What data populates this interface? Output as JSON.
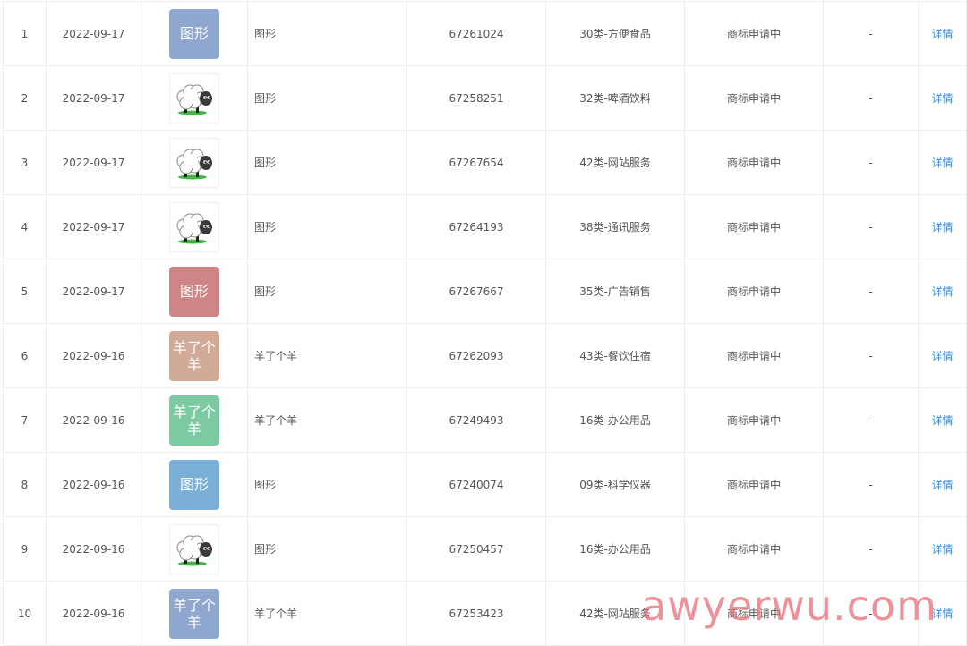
{
  "columns": {
    "detail_label": "详情"
  },
  "colors": {
    "thumb_blue_gray": "#8fa7cf",
    "thumb_red": "#cf8585",
    "thumb_tan": "#d2aa98",
    "thumb_green": "#7dc9a2",
    "thumb_blue": "#7ab0d8",
    "link": "#3b8fe0"
  },
  "rows": [
    {
      "index": "1",
      "date": "2022-09-17",
      "thumb": {
        "type": "text",
        "text": "图形",
        "color": "#8fa7cf"
      },
      "name": "图形",
      "reg_no": "67261024",
      "class": "30类-方便食品",
      "status": "商标申请中",
      "extra": "-",
      "action": "详情"
    },
    {
      "index": "2",
      "date": "2022-09-17",
      "thumb": {
        "type": "sheep-icon",
        "text": "",
        "color": "#ffffff"
      },
      "name": "图形",
      "reg_no": "67258251",
      "class": "32类-啤酒饮料",
      "status": "商标申请中",
      "extra": "-",
      "action": "详情"
    },
    {
      "index": "3",
      "date": "2022-09-17",
      "thumb": {
        "type": "sheep-icon",
        "text": "",
        "color": "#ffffff"
      },
      "name": "图形",
      "reg_no": "67267654",
      "class": "42类-网站服务",
      "status": "商标申请中",
      "extra": "-",
      "action": "详情"
    },
    {
      "index": "4",
      "date": "2022-09-17",
      "thumb": {
        "type": "sheep-icon",
        "text": "",
        "color": "#ffffff"
      },
      "name": "图形",
      "reg_no": "67264193",
      "class": "38类-通讯服务",
      "status": "商标申请中",
      "extra": "-",
      "action": "详情"
    },
    {
      "index": "5",
      "date": "2022-09-17",
      "thumb": {
        "type": "text",
        "text": "图形",
        "color": "#cf8585"
      },
      "name": "图形",
      "reg_no": "67267667",
      "class": "35类-广告销售",
      "status": "商标申请中",
      "extra": "-",
      "action": "详情"
    },
    {
      "index": "6",
      "date": "2022-09-16",
      "thumb": {
        "type": "text",
        "text": "羊了个羊",
        "color": "#d2aa98"
      },
      "name": "羊了个羊",
      "reg_no": "67262093",
      "class": "43类-餐饮住宿",
      "status": "商标申请中",
      "extra": "-",
      "action": "详情"
    },
    {
      "index": "7",
      "date": "2022-09-16",
      "thumb": {
        "type": "text",
        "text": "羊了个羊",
        "color": "#7dc9a2"
      },
      "name": "羊了个羊",
      "reg_no": "67249493",
      "class": "16类-办公用品",
      "status": "商标申请中",
      "extra": "-",
      "action": "详情"
    },
    {
      "index": "8",
      "date": "2022-09-16",
      "thumb": {
        "type": "text",
        "text": "图形",
        "color": "#7ab0d8"
      },
      "name": "图形",
      "reg_no": "67240074",
      "class": "09类-科学仪器",
      "status": "商标申请中",
      "extra": "-",
      "action": "详情"
    },
    {
      "index": "9",
      "date": "2022-09-16",
      "thumb": {
        "type": "sheep-icon",
        "text": "",
        "color": "#ffffff"
      },
      "name": "图形",
      "reg_no": "67250457",
      "class": "16类-办公用品",
      "status": "商标申请中",
      "extra": "-",
      "action": "详情"
    },
    {
      "index": "10",
      "date": "2022-09-16",
      "thumb": {
        "type": "text",
        "text": "羊了个羊",
        "color": "#8fa7cf"
      },
      "name": "羊了个羊",
      "reg_no": "67253423",
      "class": "42类-网站服务",
      "status": "商标申请中",
      "extra": "-",
      "action": "详情"
    }
  ],
  "watermark": "awyerwu.com"
}
